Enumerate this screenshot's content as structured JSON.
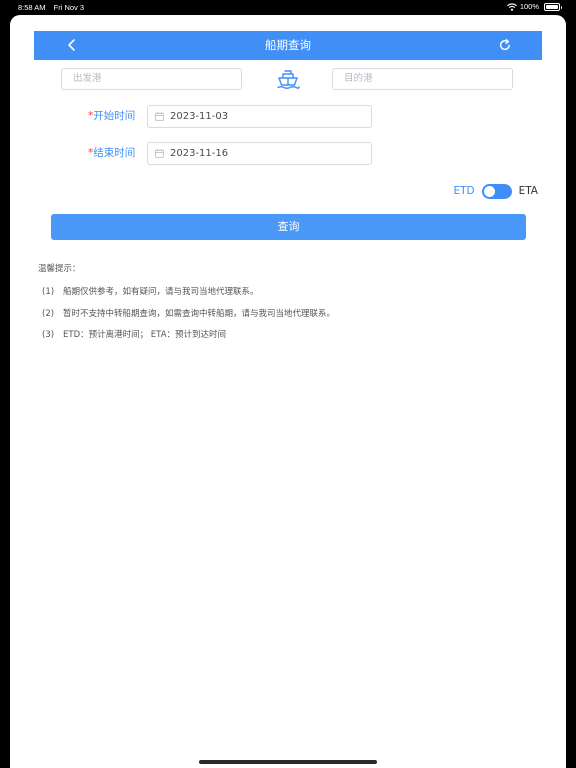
{
  "status_bar": {
    "time": "8:58 AM",
    "date": "Fri Nov 3",
    "battery": "100%"
  },
  "header": {
    "title": "船期查询"
  },
  "ports": {
    "from_placeholder": "出发港",
    "to_placeholder": "目的港"
  },
  "start": {
    "required_mark": "*",
    "label": "开始时间",
    "value": "2023-11-03"
  },
  "end": {
    "required_mark": "*",
    "label": "结束时间",
    "value": "2023-11-16"
  },
  "toggle": {
    "left_label": "ETD",
    "right_label": "ETA",
    "state": "ETD"
  },
  "query_button": "查询",
  "tips": {
    "title": "温馨提示：",
    "items": [
      {
        "num": "(1)",
        "text": "船期仅供参考，如有疑问，请与我司当地代理联系。"
      },
      {
        "num": "(2)",
        "text": "暂时不支持中转船期查询，如需查询中转船期，请与我司当地代理联系。"
      },
      {
        "num": "(3)",
        "text": "ETD：预计离港时间；  ETA：预计到达时间"
      }
    ]
  },
  "colors": {
    "accent": "#3f8ff7",
    "button": "#4a98f7",
    "required": "#f04141",
    "text": "#555555"
  },
  "icons": [
    "back-chevron-icon",
    "refresh-icon",
    "ship-icon",
    "calendar-icon",
    "wifi-icon",
    "battery-icon"
  ]
}
